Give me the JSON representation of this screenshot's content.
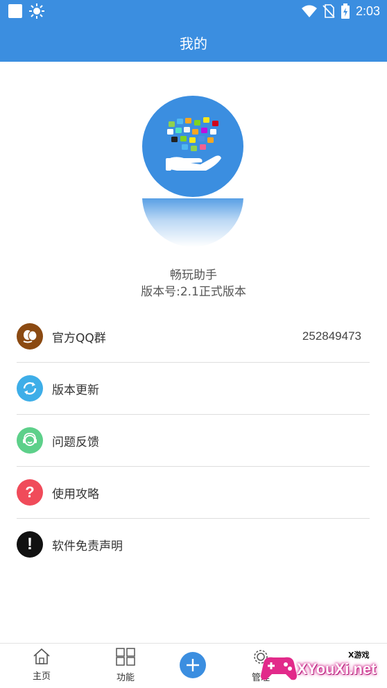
{
  "status_bar": {
    "time": "2:03",
    "icons": [
      "notification-square-icon",
      "brightness-icon",
      "wifi-icon",
      "no-sim-icon",
      "battery-charging-icon"
    ]
  },
  "header": {
    "title": "我的"
  },
  "app_info": {
    "name": "畅玩助手",
    "version": "版本号:2.1正式版本"
  },
  "menu": {
    "items": [
      {
        "label": "官方QQ群",
        "value": "252849473",
        "icon": "qq-group-icon",
        "color": "#8b4a12"
      },
      {
        "label": "版本更新",
        "icon": "refresh-icon",
        "color": "#3eaee8"
      },
      {
        "label": "问题反馈",
        "icon": "feedback-icon",
        "color": "#5dd08a"
      },
      {
        "label": "使用攻略",
        "icon": "question-icon",
        "color": "#f04b5a"
      },
      {
        "label": "软件免责声明",
        "icon": "exclamation-icon",
        "color": "#111111"
      }
    ]
  },
  "bottom_nav": {
    "items": [
      {
        "label": "主页",
        "icon": "home-icon"
      },
      {
        "label": "功能",
        "icon": "grid-icon"
      },
      {
        "label": "",
        "icon": "add-icon"
      },
      {
        "label": "管理",
        "icon": "gear-icon"
      }
    ]
  },
  "watermark": {
    "text": "XYouXi.net",
    "small": "X游戏"
  },
  "colors": {
    "primary": "#3b8ee0"
  }
}
